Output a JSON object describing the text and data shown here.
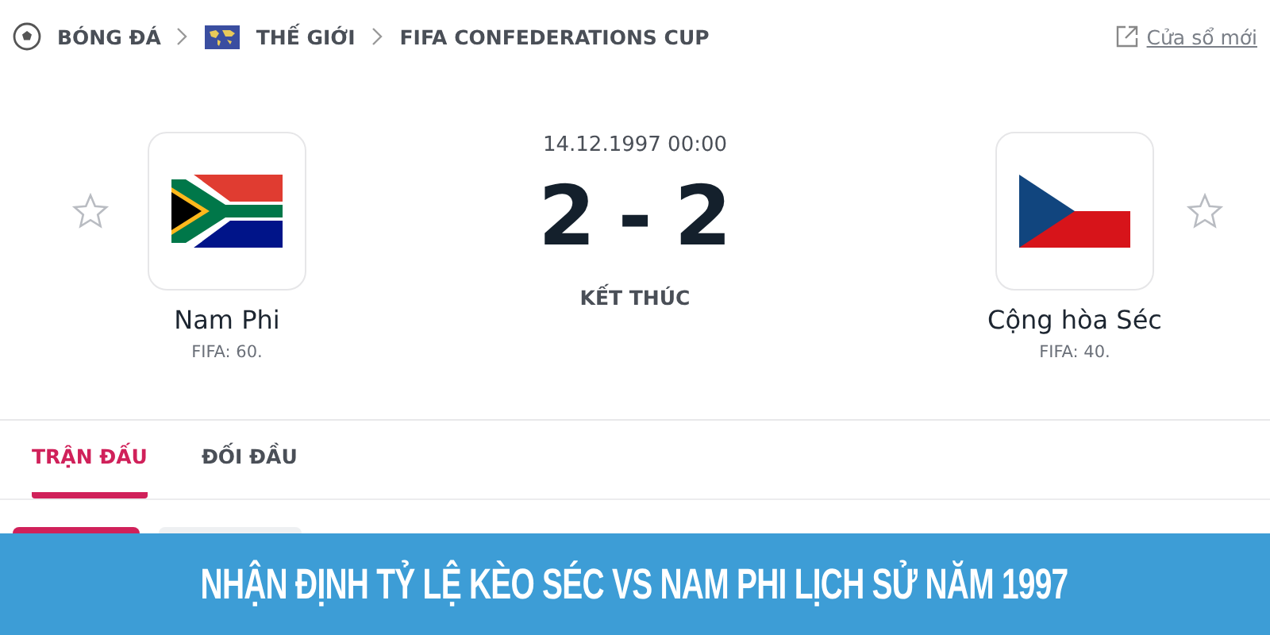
{
  "breadcrumb": [
    {
      "label": "BÓNG ĐÁ",
      "kind": "sport"
    },
    {
      "label": "THẾ GIỚI",
      "kind": "region"
    },
    {
      "label": "FIFA CONFEDERATIONS CUP",
      "kind": "plain"
    }
  ],
  "new_window_link": "Cửa sổ mới",
  "match": {
    "date": "14.12.1997 00:00",
    "home_score": "2",
    "separator": "-",
    "away_score": "2",
    "status": "KẾT THÚC"
  },
  "teams": [
    {
      "name": "Nam Phi",
      "fifa": "FIFA: 60.",
      "kind": "za",
      "favorite": false
    },
    {
      "name": "Cộng hòa Séc",
      "fifa": "FIFA: 40.",
      "kind": "cz",
      "favorite": false
    }
  ],
  "tabs": [
    {
      "label": "TRẬN ĐẤU",
      "selected": true
    },
    {
      "label": "ĐỐI ĐẦU",
      "selected": false
    }
  ],
  "banner": "NHẬN ĐỊNH TỶ LỆ KÈO SÉC VS NAM PHI LỊCH SỬ NĂM 1997"
}
